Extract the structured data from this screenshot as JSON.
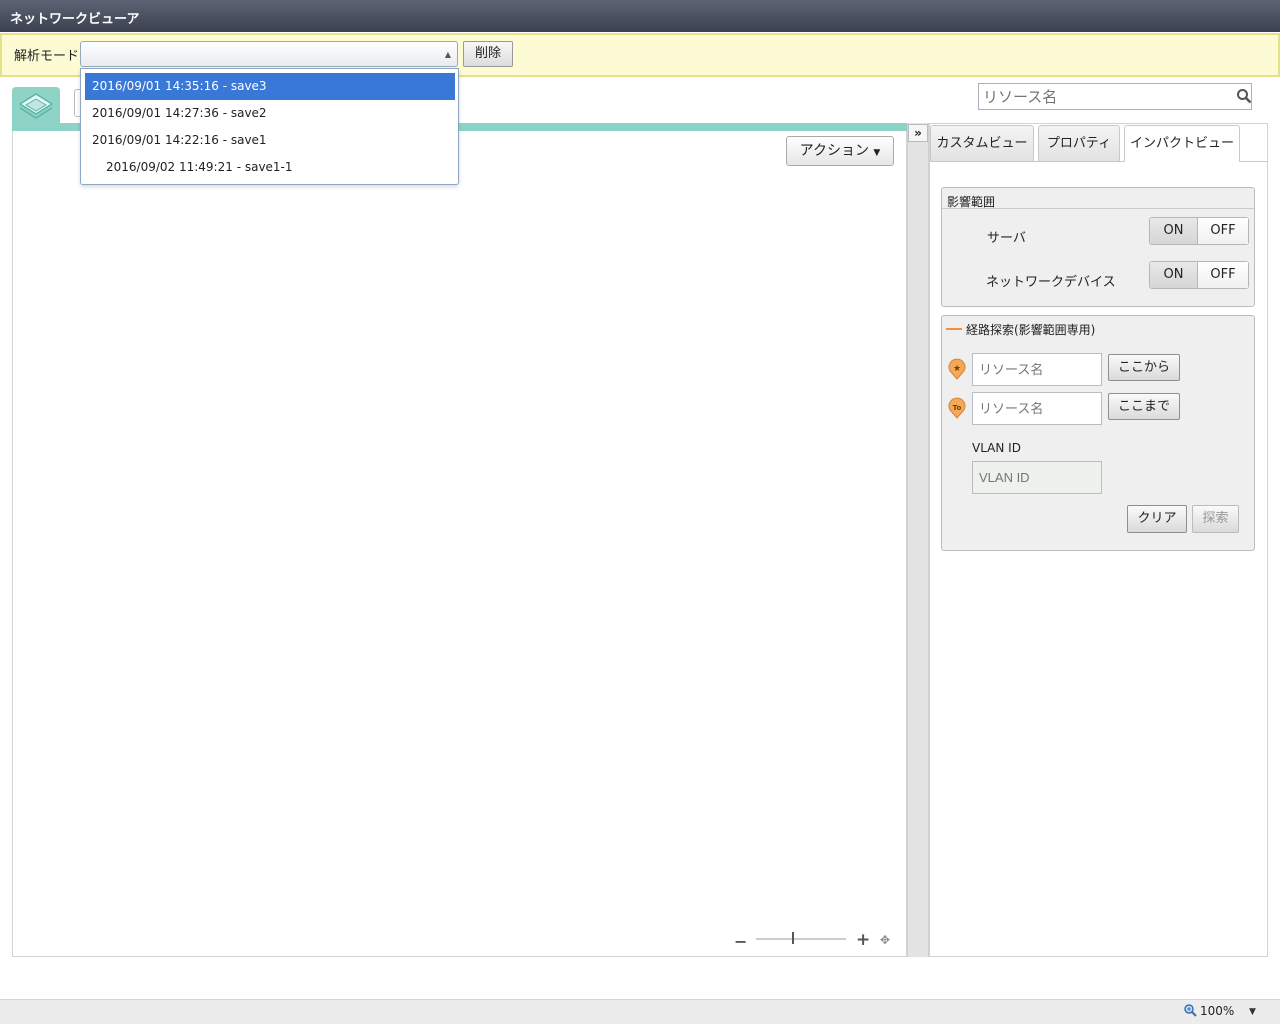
{
  "window": {
    "title": "ネットワークビューア"
  },
  "modebar": {
    "label": "解析モード",
    "combo_value": "",
    "delete_label": "削除",
    "options": [
      {
        "label": "2016/09/01 14:35:16 - save3",
        "selected": true
      },
      {
        "label": "2016/09/01 14:27:36 - save2",
        "selected": false
      },
      {
        "label": "2016/09/01 14:22:16 - save1",
        "selected": false
      },
      {
        "label": "2016/09/02 11:49:21 - save1-1",
        "selected": false,
        "child": true
      }
    ]
  },
  "search": {
    "placeholder": "リソース名"
  },
  "main": {
    "action_label": "アクション",
    "accent_color": "#8fd3c7"
  },
  "right_panel": {
    "tabs": [
      {
        "label": "カスタムビュー",
        "active": false
      },
      {
        "label": "プロパティ",
        "active": false
      },
      {
        "label": "インパクトビュー",
        "active": true
      }
    ],
    "impact_scope": {
      "title": "影響範囲",
      "rows": [
        {
          "label": "サーバ",
          "on": "ON",
          "off": "OFF",
          "value": "ON"
        },
        {
          "label": "ネットワークデバイス",
          "on": "ON",
          "off": "OFF",
          "value": "ON"
        }
      ]
    },
    "route_search": {
      "title": "経路探索(影響範囲専用)",
      "from_placeholder": "リソース名",
      "from_button": "ここから",
      "to_placeholder": "リソース名",
      "to_button": "ここまで",
      "vlan_label": "VLAN ID",
      "vlan_placeholder": "VLAN ID",
      "clear_button": "クリア",
      "search_button": "探索"
    }
  },
  "statusbar": {
    "zoom": "100%"
  }
}
